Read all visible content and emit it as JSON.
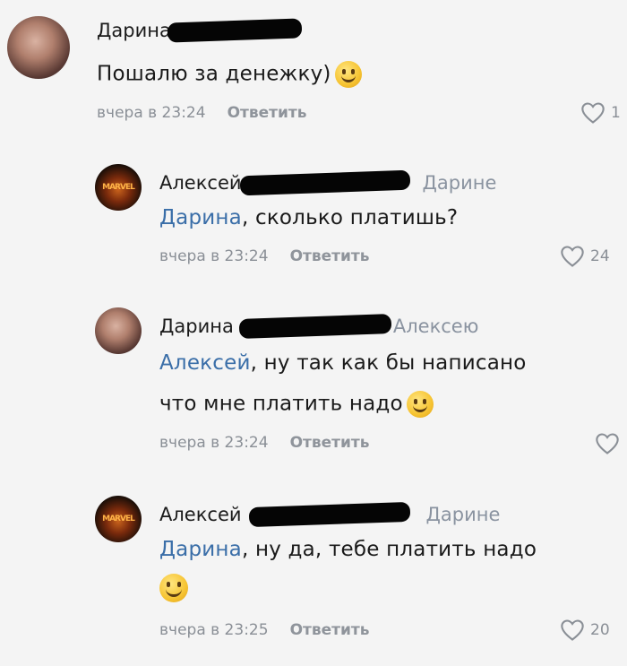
{
  "comments": [
    {
      "author": "Дарина",
      "reply_to": "",
      "mention": "",
      "text": "Пошалю за денежку)",
      "time": "вчера в 23:24",
      "reply_label": "Ответить",
      "likes": "1"
    },
    {
      "author": "Алексей",
      "reply_to": "Дарине",
      "mention": "Дарина",
      "text": ", сколько платишь?",
      "time": "вчера в 23:24",
      "reply_label": "Ответить",
      "likes": "24"
    },
    {
      "author": "Дарина",
      "reply_to": "Алексею",
      "mention": "Алексей",
      "text": ", ну так как бы написано",
      "text2": "что мне платить надо",
      "time": "вчера в 23:24",
      "reply_label": "Ответить",
      "likes": ""
    },
    {
      "author": "Алексей",
      "reply_to": "Дарине",
      "mention": "Дарина",
      "text": ", ну да, тебе платить надо",
      "time": "вчера в 23:25",
      "reply_label": "Ответить",
      "likes": "20"
    }
  ],
  "icons": {
    "like": "heart-outline-icon",
    "emoji": "smiley-emoji-icon"
  },
  "colors": {
    "mention": "#3a6ea8",
    "meta": "#8a8f96",
    "background": "#f4f4f4"
  }
}
